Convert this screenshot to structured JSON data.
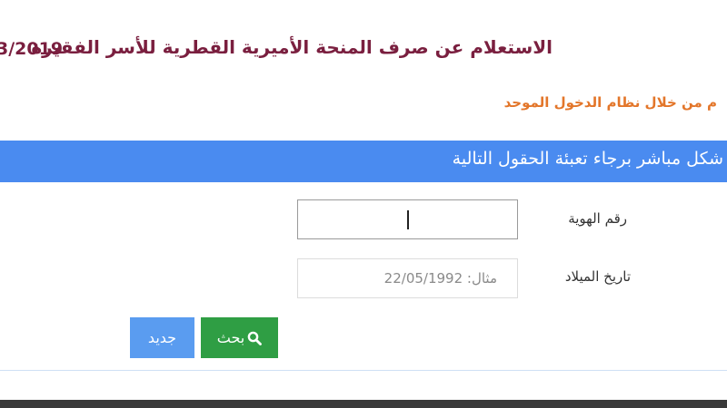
{
  "header": {
    "title": "الاستعلام عن صرف المنحة الأميرية القطرية للأسر الفقيرة",
    "title_year": "3/2019"
  },
  "notice": {
    "text": "م من خلال نظام الدخول الموحد"
  },
  "banner": {
    "text": "شكل مباشر برجاء تعبئة الحقول التالية"
  },
  "form": {
    "id_label": "رقم الهوية",
    "id_value": "",
    "dob_label": "تاريخ الميلاد",
    "dob_placeholder": "مثال: 22/05/1992",
    "search_label": "بحث",
    "new_label": "جديد"
  },
  "colors": {
    "title": "#7a1f3f",
    "notice": "#e3762a",
    "banner": "#4a8bf0",
    "search_button": "#2f9e44",
    "new_button": "#5a9cf0"
  }
}
